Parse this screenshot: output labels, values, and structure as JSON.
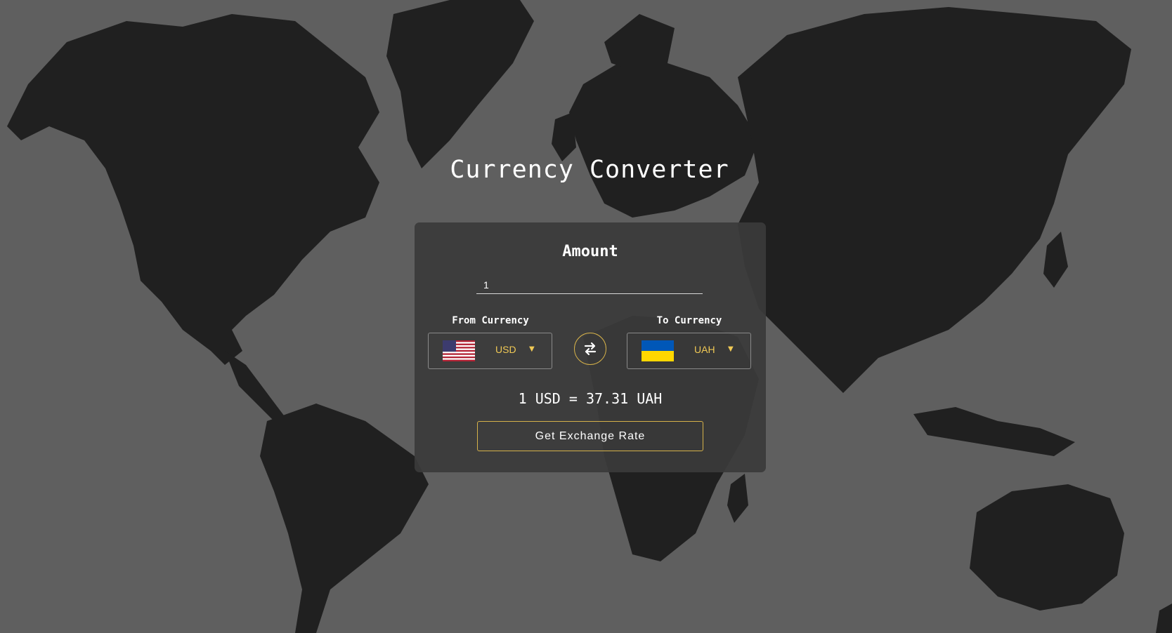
{
  "header": {
    "title": "Currency Converter"
  },
  "converter": {
    "amount_label": "Amount",
    "amount_value": "1",
    "from_label": "From Currency",
    "to_label": "To Currency",
    "from_code": "USD",
    "to_code": "UAH",
    "from_flag_icon": "us-flag-icon",
    "to_flag_icon": "ua-flag-icon",
    "swap_icon": "swap-arrows-icon",
    "result_text": "1 USD = 37.31 UAH",
    "button_label": "Get Exchange Rate"
  },
  "colors": {
    "page_background": "#5f5f5f",
    "map_land": "#202020",
    "card_background": "#3a3a3a",
    "accent": "#d6b24a",
    "currency_code": "#f0c955",
    "text": "#ffffff"
  }
}
